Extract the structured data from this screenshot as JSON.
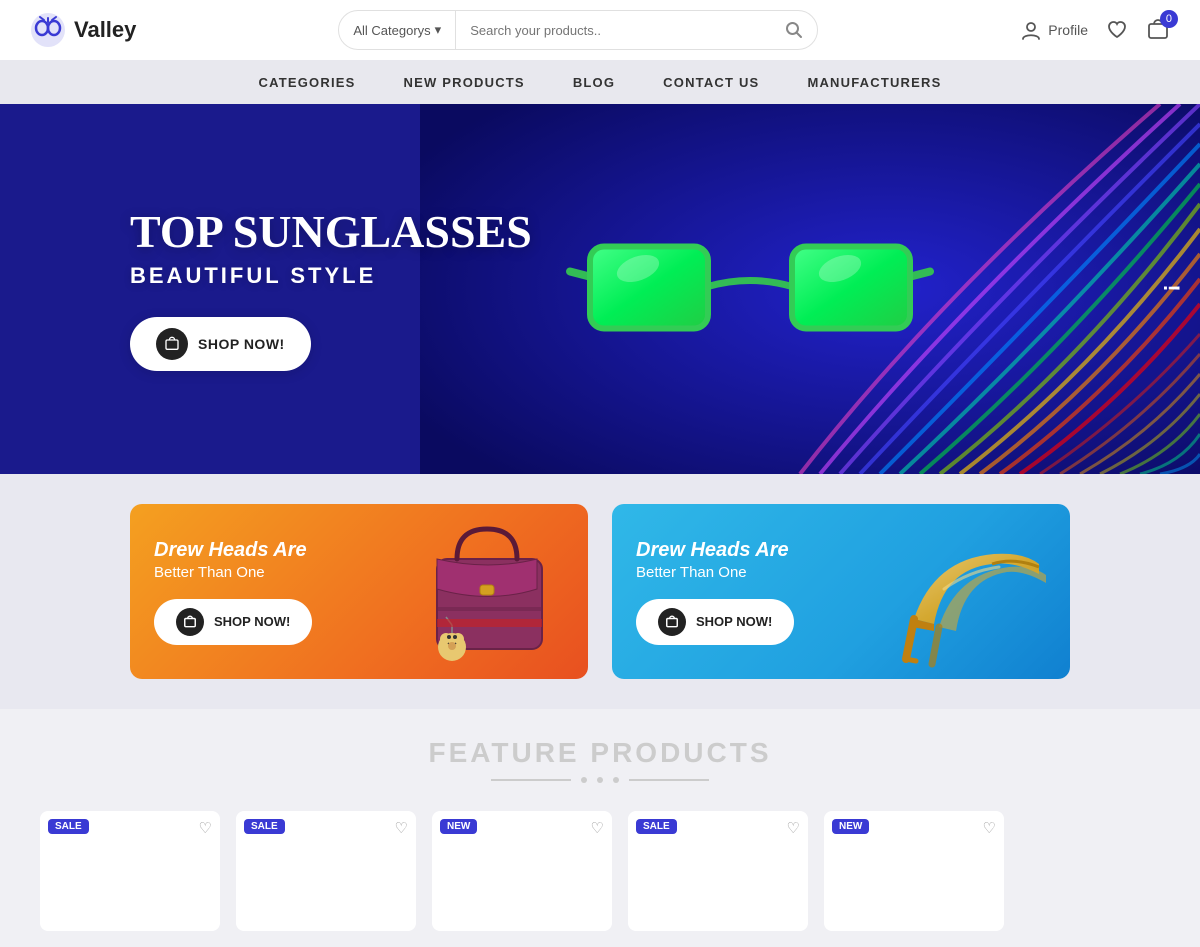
{
  "header": {
    "logo_text": "Valley",
    "search_category": "All Categorys",
    "search_placeholder": "Search your products..",
    "profile_label": "Profile",
    "cart_count": "0"
  },
  "nav": {
    "items": [
      {
        "label": "CATEGORIES"
      },
      {
        "label": "NEW PRODUCTS"
      },
      {
        "label": "BLOG"
      },
      {
        "label": "CONTACT US"
      },
      {
        "label": "MANUFACTURERS"
      }
    ]
  },
  "hero": {
    "title": "TOP SUNGLASSES",
    "subtitle": "BEAUTIFUL STYLE",
    "cta_label": "SHOP NOW!",
    "hint": "!"
  },
  "promo": {
    "cards": [
      {
        "title": "Drew Heads Are",
        "subtitle": "Better Than One",
        "cta": "SHOP NOW!"
      },
      {
        "title": "Drew Heads Are",
        "subtitle": "Better Than One",
        "cta": "SHOP NOW!"
      }
    ]
  },
  "feature": {
    "title": "FEATURE PRODUCTS"
  },
  "products": [
    {
      "badge": "SALE"
    },
    {
      "badge": "SALE"
    },
    {
      "badge": "NEW"
    },
    {
      "badge": "SALE"
    },
    {
      "badge": "NEW"
    }
  ]
}
